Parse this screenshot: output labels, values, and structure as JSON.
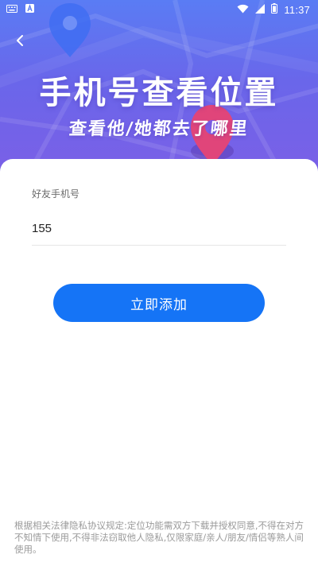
{
  "status_bar": {
    "time": "11:37",
    "left_icons": [
      "keyboard-icon",
      "font-a-icon"
    ],
    "right_icons": [
      "wifi-icon",
      "signal-icon",
      "battery-icon"
    ]
  },
  "header": {
    "back_icon": "chevron-left-icon",
    "title": "手机号查看位置",
    "subtitle": "查看他/她都去了哪里"
  },
  "form": {
    "label": "好友手机号",
    "phone_value": "155",
    "submit_label": "立即添加"
  },
  "footer": {
    "disclaimer": "根据相关法律隐私协议规定:定位功能需双方下载并授权同意,不得在对方不知情下使用,不得非法窃取他人隐私,仅限家庭/亲人/朋友/情侣等熟人间使用。"
  },
  "colors": {
    "header_gradient_top": "#5a7cf4",
    "header_gradient_bottom": "#7c5fe6",
    "primary_button": "#1574f6",
    "map_pin_blue": "#3f6df2",
    "map_pin_red": "#e0457a"
  }
}
